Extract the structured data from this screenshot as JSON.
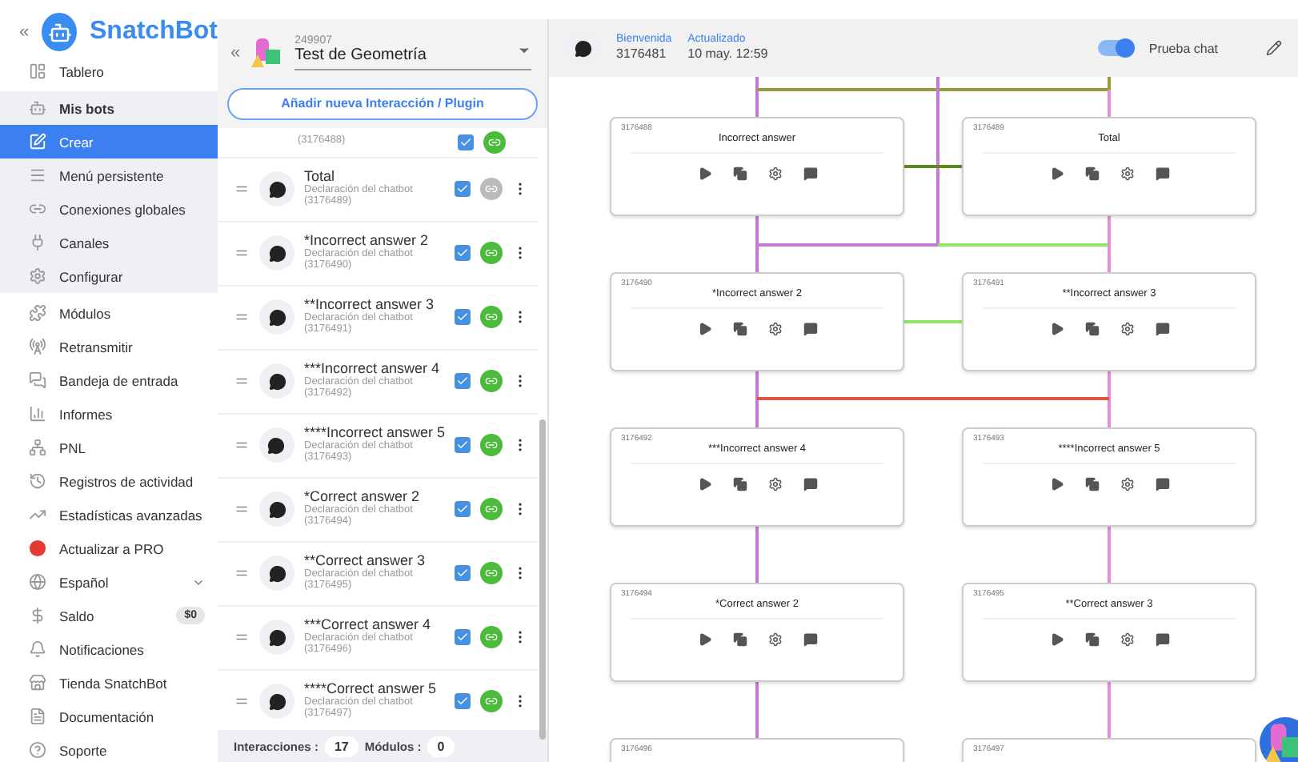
{
  "sidebar": {
    "brand": "SnatchBot",
    "collapse": "«",
    "sections": [
      {
        "kind": "plain",
        "items": [
          {
            "label": "Tablero",
            "kind": "link",
            "selected": false
          }
        ]
      },
      {
        "kind": "bot",
        "items": [
          {
            "label": "Mis bots",
            "kind": "heading",
            "selected": false
          },
          {
            "label": "Crear",
            "kind": "link",
            "selected": true
          },
          {
            "label": "Menú persistente",
            "kind": "link",
            "selected": false
          },
          {
            "label": "Conexiones globales",
            "kind": "link",
            "selected": false
          },
          {
            "label": "Canales",
            "kind": "link",
            "selected": false
          },
          {
            "label": "Configurar",
            "kind": "link",
            "selected": false
          }
        ]
      },
      {
        "kind": "plain",
        "items": [
          {
            "label": "Módulos",
            "kind": "link",
            "selected": false
          },
          {
            "label": "Retransmitir",
            "kind": "link",
            "selected": false
          },
          {
            "label": "Bandeja de entrada",
            "kind": "link",
            "selected": false
          },
          {
            "label": "Informes",
            "kind": "link",
            "selected": false
          },
          {
            "label": "PNL",
            "kind": "link",
            "selected": false
          },
          {
            "label": "Registros de actividad",
            "kind": "link",
            "selected": false
          },
          {
            "label": "Estadísticas avanzadas",
            "kind": "link",
            "selected": false
          },
          {
            "label": "Actualizar a PRO",
            "kind": "upgrade",
            "selected": false
          },
          {
            "label": "Español",
            "kind": "dropdown",
            "selected": false
          },
          {
            "label": "Saldo",
            "kind": "balance",
            "badge": "$0",
            "selected": false
          },
          {
            "label": "Notificaciones",
            "kind": "link",
            "selected": false
          },
          {
            "label": "Tienda SnatchBot",
            "kind": "link",
            "selected": false
          },
          {
            "label": "Documentación",
            "kind": "link",
            "selected": false
          },
          {
            "label": "Soporte",
            "kind": "link",
            "selected": false
          }
        ]
      }
    ]
  },
  "bot_panel": {
    "collapse": "«",
    "bot_id": "249907",
    "bot_name": "Test de Geometría",
    "add_button": "Añadir nueva Interacción / Plugin",
    "partial_item": {
      "id": "(3176488)",
      "checked": true,
      "linked": true
    },
    "items": [
      {
        "title": "Total",
        "subtitle": "Declaración del chatbot",
        "id": "(3176489)",
        "checked": true,
        "linked": false
      },
      {
        "title": "*Incorrect answer 2",
        "subtitle": "Declaración del chatbot",
        "id": "(3176490)",
        "checked": true,
        "linked": true
      },
      {
        "title": "**Incorrect answer 3",
        "subtitle": "Declaración del chatbot",
        "id": "(3176491)",
        "checked": true,
        "linked": true
      },
      {
        "title": "***Incorrect answer 4",
        "subtitle": "Declaración del chatbot",
        "id": "(3176492)",
        "checked": true,
        "linked": true
      },
      {
        "title": "****Incorrect answer 5",
        "subtitle": "Declaración del chatbot",
        "id": "(3176493)",
        "checked": true,
        "linked": true
      },
      {
        "title": "*Correct answer 2",
        "subtitle": "Declaración del chatbot",
        "id": "(3176494)",
        "checked": true,
        "linked": true
      },
      {
        "title": "**Correct answer 3",
        "subtitle": "Declaración del chatbot",
        "id": "(3176495)",
        "checked": true,
        "linked": true
      },
      {
        "title": "***Correct answer 4",
        "subtitle": "Declaración del chatbot",
        "id": "(3176496)",
        "checked": true,
        "linked": true
      },
      {
        "title": "****Correct answer 5",
        "subtitle": "Declaración del chatbot",
        "id": "(3176497)",
        "checked": true,
        "linked": true
      }
    ],
    "footer": {
      "interactions_label": "Interacciones :",
      "interactions": "17",
      "modules_label": "Módulos :",
      "modules": "0"
    }
  },
  "canvas": {
    "header": {
      "welcome_label": "Bienvenida",
      "welcome_id": "3176481",
      "updated_label": "Actualizado",
      "updated": "10 may. 12:59",
      "test_chat": {
        "label": "Prueba chat",
        "on": true
      }
    },
    "nodes": [
      {
        "id": "3176488",
        "title": "Incorrect answer"
      },
      {
        "id": "3176489",
        "title": "Total"
      },
      {
        "id": "3176490",
        "title": "*Incorrect answer 2"
      },
      {
        "id": "3176491",
        "title": "**Incorrect answer 3"
      },
      {
        "id": "3176492",
        "title": "***Incorrect answer 4"
      },
      {
        "id": "3176493",
        "title": "****Incorrect answer 5"
      },
      {
        "id": "3176494",
        "title": "*Correct answer 2"
      },
      {
        "id": "3176495",
        "title": "**Correct answer 3"
      },
      {
        "id": "3176496"
      },
      {
        "id": "3176497"
      }
    ]
  }
}
